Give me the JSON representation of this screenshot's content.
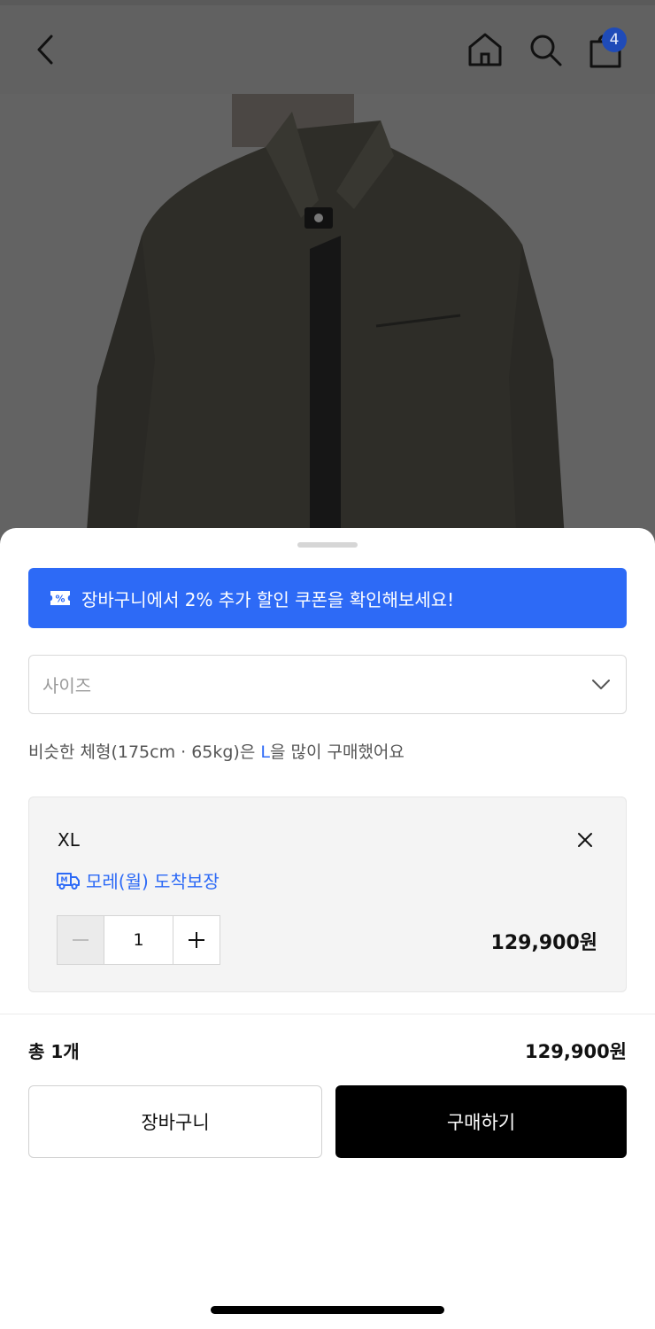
{
  "header": {
    "back_icon": "chevron-left-icon",
    "home_icon": "home-icon",
    "search_icon": "search-icon",
    "cart_icon": "shopping-bag-icon",
    "cart_count": "4"
  },
  "sheet": {
    "promo_text": "장바구니에서 2% 추가 할인 쿠폰을 확인해보세요!",
    "size_placeholder": "사이즈",
    "recommend_prefix": "비슷한 체형(175cm · 65kg)은 ",
    "recommend_size": "L",
    "recommend_suffix": "을 많이 구매했어요",
    "selected_option": {
      "name": "XL",
      "delivery": "모레(월) 도착보장",
      "quantity": "1",
      "price": "129,900원"
    },
    "total_label": "총 1개",
    "total_price": "129,900원",
    "cart_button": "장바구니",
    "buy_button": "구매하기"
  },
  "colors": {
    "accent": "#2d6af6",
    "buy_button": "#000000",
    "badge": "#1f4bb8"
  }
}
